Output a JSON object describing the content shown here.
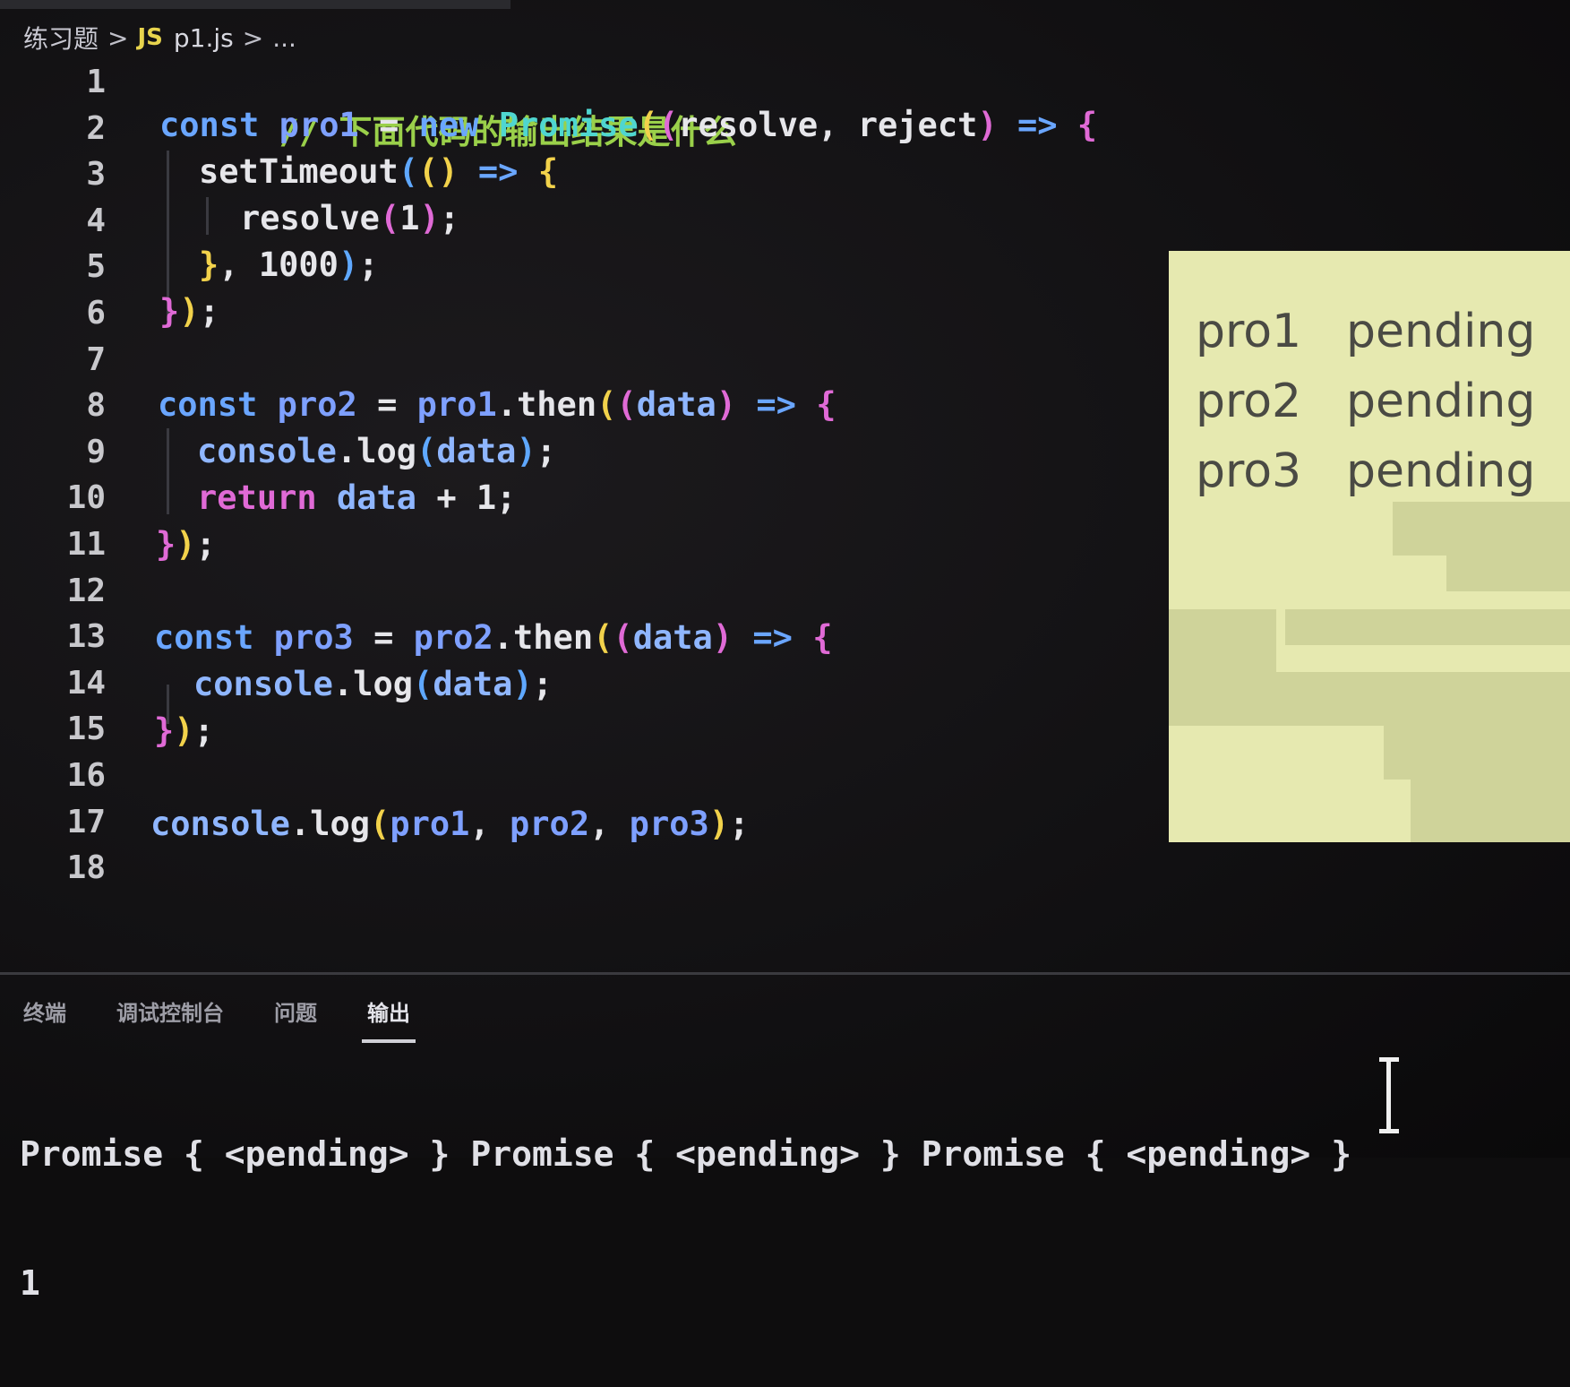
{
  "breadcrumb": {
    "folder": "练习题",
    "sep1": ">",
    "file_badge": "JS",
    "file": "p1.js",
    "sep2": ">",
    "more": "..."
  },
  "editor": {
    "line_numbers": [
      "1",
      "2",
      "3",
      "4",
      "5",
      "6",
      "7",
      "8",
      "9",
      "10",
      "11",
      "12",
      "13",
      "14",
      "15",
      "16",
      "17",
      "18"
    ],
    "lines": {
      "l1": {
        "comment": "// 下面代码的输出结果是什么"
      },
      "l2": {
        "kw": "const",
        "name": "pro1",
        "eq": "=",
        "new": "new",
        "cls": "Promise",
        "p1": "(",
        "p2": "(",
        "args": "resolve, reject",
        "p3": ")",
        "arrow": "=>",
        "brace": "{"
      },
      "l3": {
        "fn": "setTimeout",
        "p1": "(",
        "p2": "()",
        "arrow": "=>",
        "brace": "{"
      },
      "l4": {
        "fn": "resolve",
        "p1": "(",
        "num": "1",
        "p2": ")",
        "semi": ";"
      },
      "l5": {
        "brace": "}",
        "rest": ", 1000",
        "p": ")",
        "semi": ";"
      },
      "l6": {
        "brace": "}",
        "p": ")",
        "semi": ";"
      },
      "l8": {
        "kw": "const",
        "name": "pro2",
        "eq": "=",
        "obj": "pro1",
        "method": ".then",
        "p1": "(",
        "p2": "(",
        "arg": "data",
        "p3": ")",
        "arrow": "=>",
        "brace": "{"
      },
      "l9": {
        "obj": "console",
        "method": ".log",
        "p1": "(",
        "arg": "data",
        "p2": ")",
        "semi": ";"
      },
      "l10": {
        "ret": "return",
        "arg": "data",
        "rest": " + 1;"
      },
      "l11": {
        "brace": "}",
        "p": ")",
        "semi": ";"
      },
      "l13": {
        "kw": "const",
        "name": "pro3",
        "eq": "=",
        "obj": "pro2",
        "method": ".then",
        "p1": "(",
        "p2": "(",
        "arg": "data",
        "p3": ")",
        "arrow": "=>",
        "brace": "{"
      },
      "l14": {
        "obj": "console",
        "method": ".log",
        "p1": "(",
        "arg": "data",
        "p2": ")",
        "semi": ";"
      },
      "l15": {
        "brace": "}",
        "p": ")",
        "semi": ";"
      },
      "l17": {
        "obj": "console",
        "method": ".log",
        "p1": "(",
        "a1": "pro1",
        "c1": ", ",
        "a2": "pro2",
        "c2": ", ",
        "a3": "pro3",
        "p2": ")",
        "semi": ";"
      }
    }
  },
  "note_panel": {
    "rows": [
      {
        "name": "pro1",
        "state": "pending"
      },
      {
        "name": "pro2",
        "state": "pending"
      },
      {
        "name": "pro3",
        "state": "pending"
      }
    ]
  },
  "panel": {
    "tabs": [
      {
        "label": "终端",
        "active": false
      },
      {
        "label": "调试控制台",
        "active": false
      },
      {
        "label": "问题",
        "active": false
      },
      {
        "label": "输出",
        "active": true
      }
    ],
    "output": [
      "Promise { <pending> } Promise { <pending> } Promise { <pending> }",
      "1"
    ]
  },
  "colors": {
    "background": "#121113",
    "keyword": "#6aa6ff",
    "comment": "#9ad04a",
    "class": "#4fd6d0",
    "paren_yellow": "#f2d24b",
    "paren_magenta": "#e06ad6",
    "note_bg": "#e6e9b0"
  }
}
